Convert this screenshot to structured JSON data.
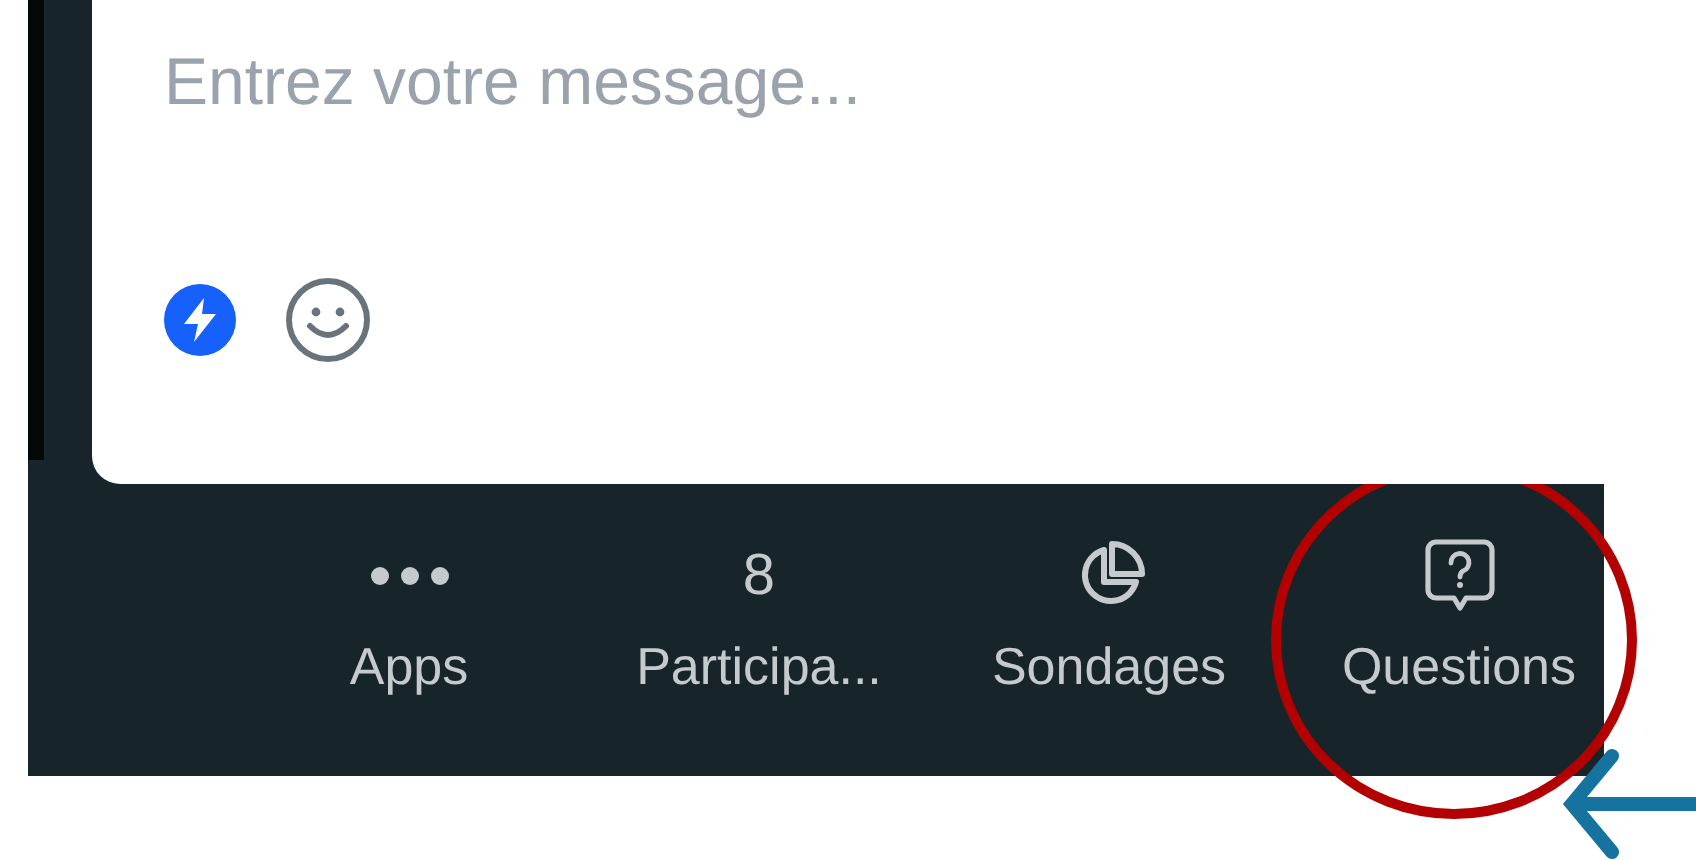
{
  "composer": {
    "placeholder": "Entrez votre message..."
  },
  "bottom_bar": [
    {
      "kind": "dots",
      "label": "Apps"
    },
    {
      "kind": "count",
      "count": "8",
      "label": "Participa..."
    },
    {
      "kind": "poll",
      "label": "Sondages"
    },
    {
      "kind": "question",
      "label": "Questions"
    }
  ]
}
